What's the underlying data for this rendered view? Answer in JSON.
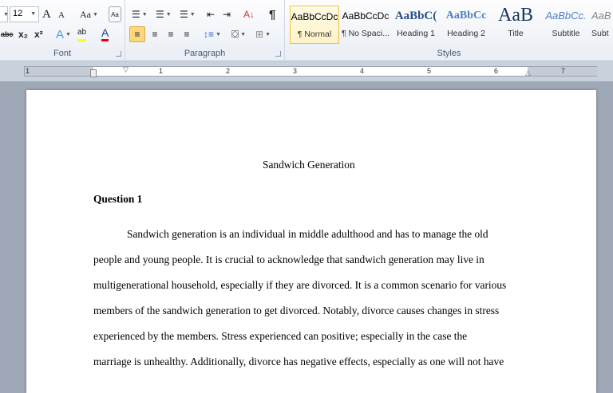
{
  "font_group": {
    "label": "Font",
    "font_size": "12",
    "buttons": [
      "A",
      "A",
      "Aa",
      "abc",
      "x₂",
      "x²",
      "A",
      "ab",
      "A"
    ],
    "colors": {
      "highlight": "#ffff00",
      "font_color": "#e00000"
    }
  },
  "paragraph_group": {
    "label": "Paragraph",
    "pilcrow": "¶"
  },
  "styles_group": {
    "label": "Styles",
    "items": [
      {
        "preview": "AaBbCcDc",
        "name": "¶ Normal",
        "selected": true
      },
      {
        "preview": "AaBbCcDc",
        "name": "¶ No Spaci..."
      },
      {
        "preview": "AaBbC(",
        "name": "Heading 1"
      },
      {
        "preview": "AaBbCc",
        "name": "Heading 2"
      },
      {
        "preview": "AaB",
        "name": "Title"
      },
      {
        "preview": "AaBbCc.",
        "name": "Subtitle"
      },
      {
        "preview": "AaB",
        "name": "Subt"
      }
    ]
  },
  "ruler": {
    "numbers": [
      "1",
      "1",
      "2",
      "3",
      "4",
      "5",
      "6",
      "7"
    ]
  },
  "document": {
    "title": "Sandwich Generation",
    "heading": "Question 1",
    "lines": [
      "Sandwich generation is an individual in middle adulthood and has to manage the old",
      "people and young people. It is crucial to acknowledge that sandwich generation may live in",
      "multigenerational household, especially if they are divorced. It is a common scenario  for various",
      "members  of the sandwich generation to get divorced. Notably, divorce causes changes in stress",
      "experienced by the members.   Stress experienced can positive; especially in the case the",
      "marriage  is unhealthy. Additionally, divorce has negative effects, especially  as one will not have"
    ]
  }
}
